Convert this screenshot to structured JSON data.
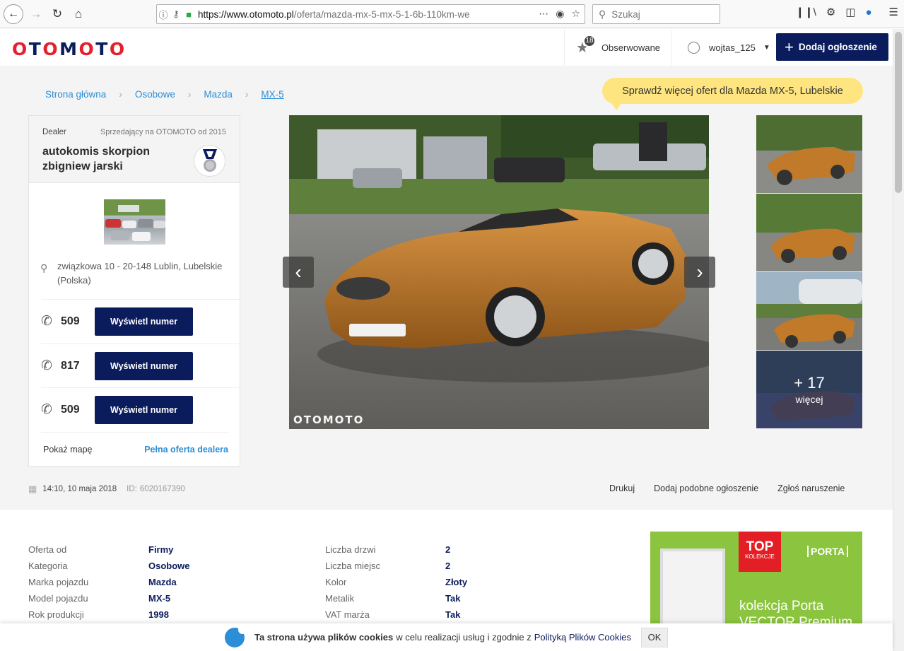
{
  "browser": {
    "url_host": "https://www.otomoto.pl",
    "url_path": "/oferta/mazda-mx-5-mx-5-1-6b-110km-we",
    "search_placeholder": "Szukaj"
  },
  "header": {
    "logo": "OTOMOTO",
    "favorites_count": "18",
    "favorites_label": "Obserwowane",
    "username": "wojtas_125",
    "add_button": "Dodaj ogłoszenie"
  },
  "breadcrumb": [
    "Strona główna",
    "Osobowe",
    "Mazda",
    "MX-5"
  ],
  "tooltip": "Sprawdź więcej ofert dla Mazda MX-5, Lubelskie",
  "dealer": {
    "type_label": "Dealer",
    "since": "Sprzedający na OTOMOTO od 2015",
    "name": "autokomis skorpion zbigniew jarski",
    "address": "związkowa 10 - 20-148 Lublin, Lubelskie (Polska)",
    "phones": [
      {
        "prefix": "509",
        "button": "Wyświetl numer"
      },
      {
        "prefix": "817",
        "button": "Wyświetl numer"
      },
      {
        "prefix": "509",
        "button": "Wyświetl numer"
      }
    ],
    "show_map": "Pokaż mapę",
    "full_offer": "Pełna oferta dealera"
  },
  "gallery": {
    "watermark": "OTOMOTO",
    "more_count": "+ 17",
    "more_label": "więcej",
    "car_color": "#c07a2a"
  },
  "meta": {
    "date": "14:10, 10 maja 2018",
    "id_label": "ID:",
    "id": "6020167390",
    "actions": [
      "Drukuj",
      "Dodaj podobne ogłoszenie",
      "Zgłoś naruszenie"
    ]
  },
  "params_left": [
    {
      "k": "Oferta od",
      "v": "Firmy"
    },
    {
      "k": "Kategoria",
      "v": "Osobowe"
    },
    {
      "k": "Marka pojazdu",
      "v": "Mazda"
    },
    {
      "k": "Model pojazdu",
      "v": "MX-5"
    },
    {
      "k": "Rok produkcji",
      "v": "1998"
    }
  ],
  "params_right": [
    {
      "k": "Liczba drzwi",
      "v": "2"
    },
    {
      "k": "Liczba miejsc",
      "v": "2"
    },
    {
      "k": "Kolor",
      "v": "Złoty"
    },
    {
      "k": "Metalik",
      "v": "Tak"
    },
    {
      "k": "VAT marża",
      "v": "Tak"
    }
  ],
  "ad": {
    "top": "TOP",
    "kolekcje": "KOLEKCJE",
    "brand": "PORTA",
    "text1": "kolekcja Porta",
    "text2": "VECTOR Premium"
  },
  "cookie": {
    "bold": "Ta strona używa plików cookies",
    "text": "w celu realizacji usług i zgodnie z",
    "policy": "Polityką Plików Cookies",
    "ok": "OK"
  }
}
